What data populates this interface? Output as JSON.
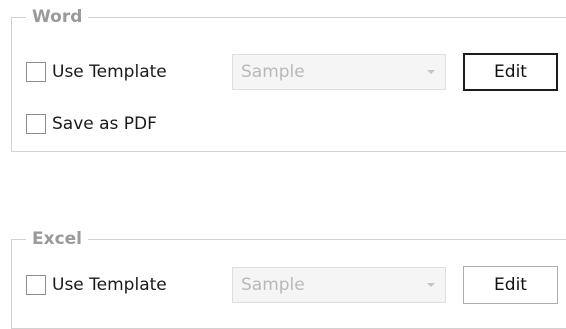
{
  "word": {
    "title": "Word",
    "use_template": {
      "label": "Use Template",
      "checked": false
    },
    "template_select": {
      "value": "Sample",
      "enabled": false
    },
    "edit_label": "Edit",
    "save_as_pdf": {
      "label": "Save as PDF",
      "checked": false
    }
  },
  "excel": {
    "title": "Excel",
    "use_template": {
      "label": "Use Template",
      "checked": false
    },
    "template_select": {
      "value": "Sample",
      "enabled": false
    },
    "edit_label": "Edit"
  }
}
